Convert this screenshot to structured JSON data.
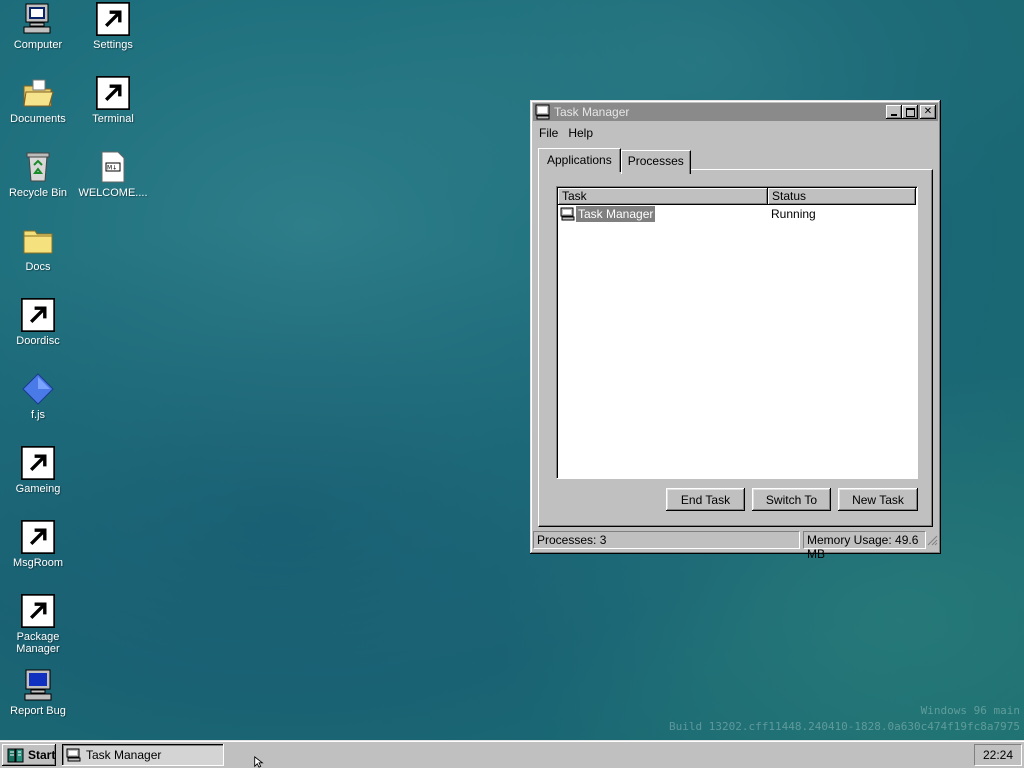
{
  "desktop": {
    "icons": [
      {
        "label": "Computer",
        "icon": "computer-icon"
      },
      {
        "label": "Settings",
        "icon": "settings-icon"
      },
      {
        "label": "Documents",
        "icon": "folder-open-icon"
      },
      {
        "label": "Terminal",
        "icon": "terminal-icon"
      },
      {
        "label": "Recycle Bin",
        "icon": "recycle-bin-icon"
      },
      {
        "label": "WELCOME....",
        "icon": "markdown-file-icon"
      },
      {
        "label": "Docs",
        "icon": "folder-icon"
      },
      {
        "label": "Doordisc",
        "icon": "discord-icon"
      },
      {
        "label": "f.js",
        "icon": "js-file-icon"
      },
      {
        "label": "Gameing",
        "icon": "game-cube-icon"
      },
      {
        "label": "MsgRoom",
        "icon": "msgroom-icon"
      },
      {
        "label": "Package Manager",
        "icon": "package-manager-icon"
      },
      {
        "label": "Report Bug",
        "icon": "report-bug-icon"
      }
    ],
    "watermark_line1": "Windows 96 main",
    "watermark_line2": "Build 13202.cff11448.240410-1828.0a630c474f19fc8a7975"
  },
  "window": {
    "title": "Task Manager",
    "menu": [
      "File",
      "Help"
    ],
    "tabs": [
      "Applications",
      "Processes"
    ],
    "active_tab": "Applications",
    "list": {
      "columns": [
        "Task",
        "Status"
      ],
      "rows": [
        {
          "task": "Task Manager",
          "status": "Running"
        }
      ]
    },
    "buttons": {
      "end_task": "End Task",
      "switch_to": "Switch To",
      "new_task": "New Task"
    },
    "status": {
      "processes": "Processes: 3",
      "memory": "Memory Usage: 49.6 MB"
    }
  },
  "taskbar": {
    "start_label": "Start",
    "items": [
      "Task Manager"
    ],
    "clock": "22:24"
  },
  "colors": {
    "desktop": "#1e6f7d",
    "chrome": "#c0c0c0",
    "title_inactive": "#8a8a8a",
    "selection": "#808080"
  }
}
